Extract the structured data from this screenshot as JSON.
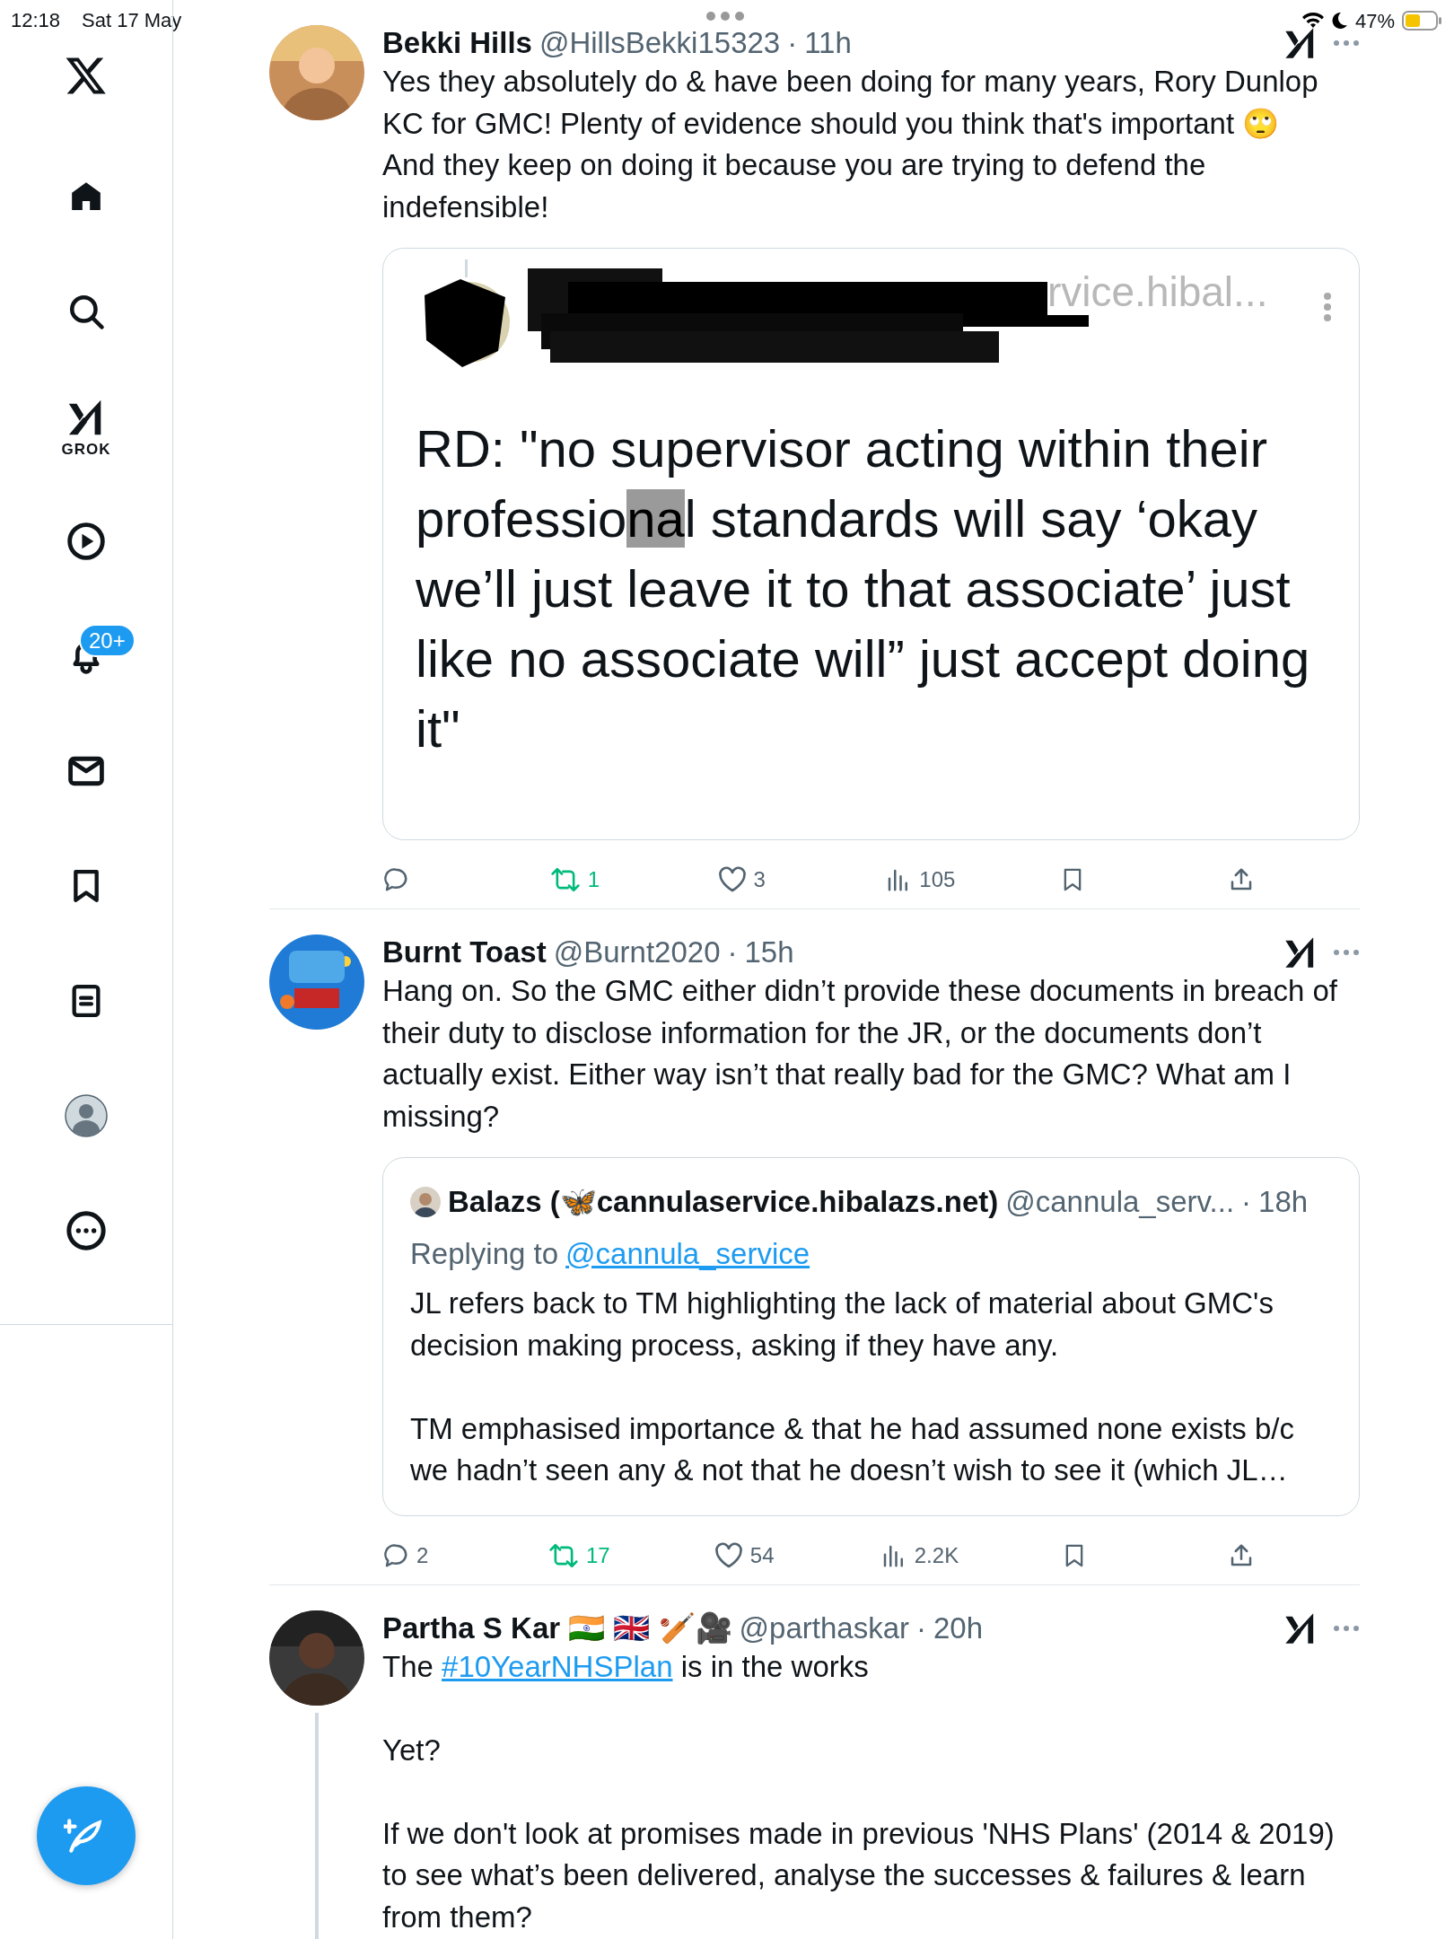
{
  "status_bar": {
    "time": "12:18",
    "date": "Sat 17 May",
    "battery": "47%"
  },
  "sidebar": {
    "items": [
      {
        "kind": "logo"
      },
      {
        "kind": "home",
        "selected": true
      },
      {
        "kind": "search",
        "selected": false
      },
      {
        "kind": "grok",
        "label": "GROK",
        "selected": false
      },
      {
        "kind": "video",
        "selected": false
      },
      {
        "kind": "notifications",
        "badge": "20+",
        "selected": false
      },
      {
        "kind": "messages",
        "selected": false
      },
      {
        "kind": "bookmarks",
        "selected": false
      },
      {
        "kind": "lists",
        "selected": false
      },
      {
        "kind": "profile",
        "selected": false
      },
      {
        "kind": "more",
        "selected": false
      }
    ]
  },
  "tweets": [
    {
      "author": {
        "name": "Bekki Hills",
        "handle": "@HillsBekki15323",
        "separator": "·",
        "time": "11h"
      },
      "paragraphs": [
        [
          {
            "kind": "text",
            "text": "Yes they absolutely do & have been doing for many years, Rory Dunlop KC for GMC! Plenty of evidence should you think that's important 🙄"
          },
          {
            "kind": "break"
          },
          {
            "kind": "text",
            "text": "And they keep on doing it because you are trying to defend the indefensible!"
          }
        ]
      ],
      "quote": {
        "kind": "screenshot",
        "name_fragment": "rvice.hibal...",
        "text": "RD: \"no supervisor acting within their professio**na**l standards will say ‘okay we’ll just leave it to that associate’ just like no associate will” just accept doing it\""
      },
      "actions": {
        "retweets": "1",
        "retweeted": true,
        "likes": "3",
        "liked": false,
        "views": "105"
      }
    },
    {
      "author": {
        "name": "Burnt Toast",
        "handle": "@Burnt2020",
        "separator": "·",
        "time": "15h"
      },
      "paragraphs": [
        [
          {
            "kind": "text",
            "text": "Hang on. So the GMC either didn’t provide these documents in breach of their duty to disclose information for the JR, or the documents don’t actually exist. Either way isn’t that really bad for the GMC? What am I missing?"
          }
        ]
      ],
      "quote": {
        "kind": "tweet",
        "name": "Balazs (🦋cannulaservice.hibalazs.net)",
        "handle": "@cannula_serv...",
        "separator": "·",
        "time": "18h",
        "replying_label": "Replying to",
        "replying_to": "@cannula_service",
        "paragraphs": [
          "JL refers back to TM highlighting the lack of material about GMC's decision making process, asking if they have any.",
          "TM emphasised importance & that he had assumed none exists b/c we hadn’t seen any & not that he doesn’t wish to see it (which JL…"
        ]
      },
      "actions": {
        "replies": "2",
        "retweets": "17",
        "retweeted": true,
        "likes": "54",
        "liked": false,
        "views": "2.2K"
      }
    },
    {
      "author": {
        "name": "Partha S Kar 🇮🇳 🇬🇧 🏏🎥",
        "handle": "@parthaskar",
        "separator": "·",
        "time": "20h"
      },
      "thread": true,
      "paragraphs": [
        [
          {
            "kind": "text",
            "text": "The "
          },
          {
            "kind": "link",
            "text": "#10YearNHSPlan"
          },
          {
            "kind": "text",
            "text": " is in the works"
          }
        ],
        [
          {
            "kind": "text",
            "text": "Yet?"
          }
        ],
        [
          {
            "kind": "text",
            "text": "If we don't look at promises made in previous 'NHS Plans' (2014 & 2019) to see what’s been delivered, analyse the successes & failures & learn from them?"
          }
        ]
      ]
    }
  ]
}
